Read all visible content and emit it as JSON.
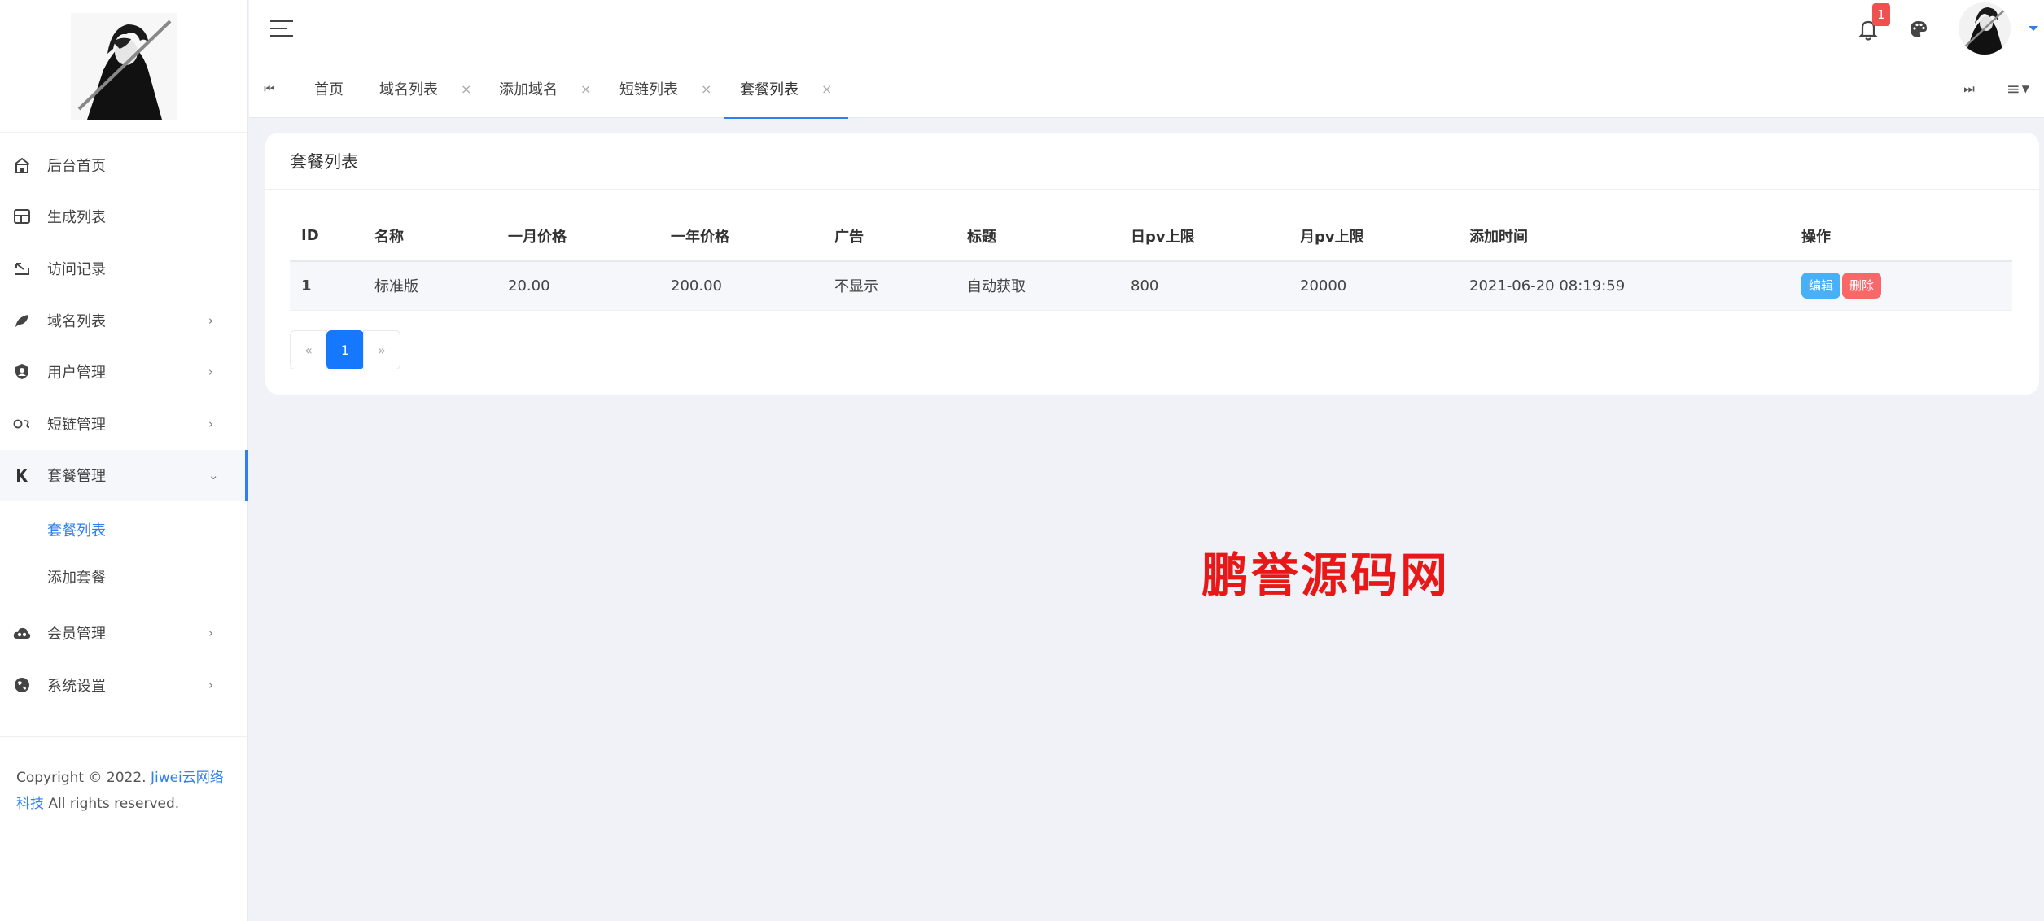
{
  "sidebar": {
    "items": [
      {
        "label": "后台首页",
        "icon": "home-icon",
        "arrow": ""
      },
      {
        "label": "生成列表",
        "icon": "layout-icon",
        "arrow": ""
      },
      {
        "label": "访问记录",
        "icon": "redirect-icon",
        "arrow": ""
      },
      {
        "label": "域名列表",
        "icon": "leaf-icon",
        "arrow": "›"
      },
      {
        "label": "用户管理",
        "icon": "user-shield-icon",
        "arrow": "›"
      },
      {
        "label": "短链管理",
        "icon": "link-icon",
        "arrow": "›"
      },
      {
        "label": "套餐管理",
        "icon": "k-icon",
        "arrow": "⌄"
      },
      {
        "label": "会员管理",
        "icon": "cloud-icon",
        "arrow": "›"
      },
      {
        "label": "系统设置",
        "icon": "globe-icon",
        "arrow": "›"
      }
    ],
    "submenu": [
      {
        "label": "套餐列表"
      },
      {
        "label": "添加套餐"
      }
    ],
    "copyright": {
      "prefix": "Copyright © 2022. ",
      "link": "Jiwei云网络科技",
      "suffix": " All rights reserved."
    }
  },
  "header": {
    "notification_count": "1"
  },
  "tabs": {
    "prev": "⏮",
    "next": "⏭",
    "menu": "≡",
    "items": [
      {
        "label": "首页",
        "close": ""
      },
      {
        "label": "域名列表",
        "close": "×"
      },
      {
        "label": "添加域名",
        "close": "×"
      },
      {
        "label": "短链列表",
        "close": "×"
      },
      {
        "label": "套餐列表",
        "close": "×"
      }
    ]
  },
  "main": {
    "title": "套餐列表",
    "table": {
      "headers": [
        "ID",
        "名称",
        "一月价格",
        "一年价格",
        "广告",
        "标题",
        "日pv上限",
        "月pv上限",
        "添加时间",
        "操作"
      ],
      "rows": [
        [
          "1",
          "标准版",
          "20.00",
          "200.00",
          "不显示",
          "自动获取",
          "800",
          "20000",
          "2021-06-20 08:19:59"
        ]
      ],
      "edit_label": "编辑",
      "delete_label": "删除"
    },
    "pagination": {
      "prev": "«",
      "current": "1",
      "next": "»"
    }
  },
  "watermark": "鹏誉源码网"
}
